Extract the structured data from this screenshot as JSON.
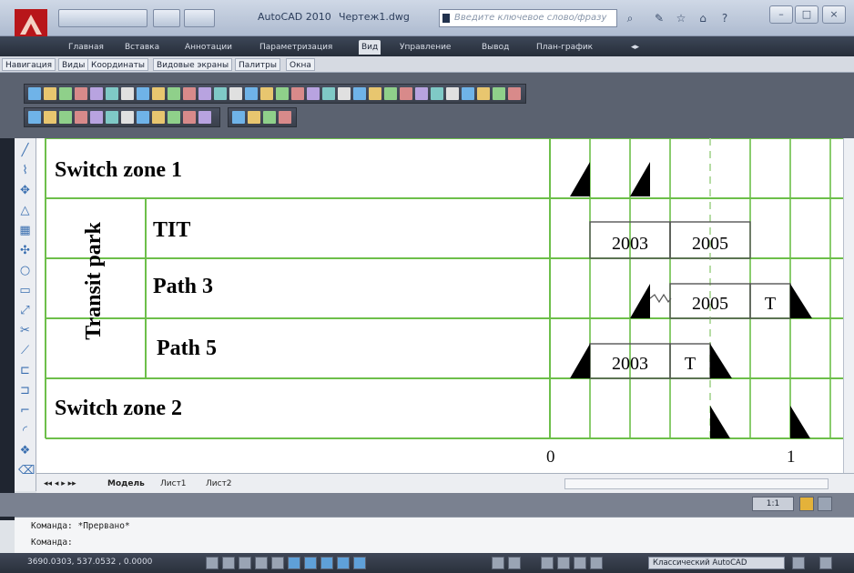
{
  "titlebar": {
    "app_title": "AutoCAD 2010",
    "doc_title": "Чертеж1.dwg",
    "search_placeholder": "Введите ключевое слово/фразу"
  },
  "ribbon_tabs": [
    "Главная",
    "Вставка",
    "Аннотации",
    "Параметризация",
    "Вид",
    "Управление",
    "Вывод",
    "План-график"
  ],
  "ribbon_active_tab": "Вид",
  "panel_tabs": [
    "Навигация",
    "Виды",
    "Координаты",
    "Видовые экраны",
    "Палитры",
    "Окна"
  ],
  "drawing": {
    "rows": [
      {
        "label": "Switch zone 1"
      },
      {
        "label": "TIT"
      },
      {
        "label": "Path 3"
      },
      {
        "label": "Path 5"
      },
      {
        "label": "Switch zone 2"
      }
    ],
    "group_label": "Transit park",
    "timeline_boxes": [
      {
        "label": "2003"
      },
      {
        "label": "2005"
      },
      {
        "label": "2005"
      },
      {
        "label": "T"
      },
      {
        "label": "2003"
      },
      {
        "label": "T"
      }
    ],
    "scale_labels": [
      "0",
      "1"
    ],
    "grid_color": "#6dbf4a"
  },
  "layout_tabs": [
    "Модель",
    "Лист1",
    "Лист2"
  ],
  "annotation_scale": "1:1",
  "command_lines": [
    "Команда: *Прервано*",
    "Команда:"
  ],
  "status": {
    "coordinates": "3690.0303, 537.0532 , 0.0000",
    "workspace": "Классический AutoCAD"
  }
}
